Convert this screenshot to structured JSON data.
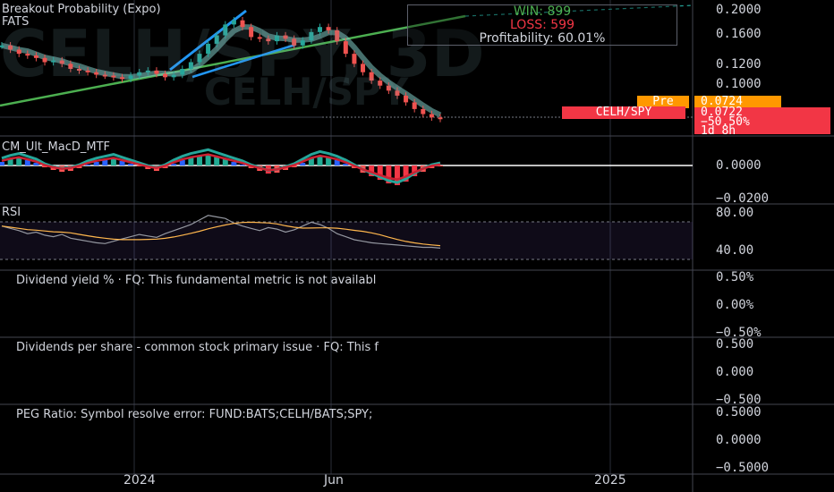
{
  "watermark": {
    "symbol": "CELH/SPY, 3D",
    "sub": "CELH/SPY"
  },
  "panes": {
    "main": {
      "title": "Breakout Probability (Expo)",
      "subtitle": "FATS"
    },
    "macd": {
      "title": "CM_Ult_MacD_MTF"
    },
    "rsi": {
      "title": "RSI"
    },
    "dividend_yield": {
      "title": "Dividend yield % · FQ: This fundamental metric is not availabl"
    },
    "dps": {
      "title": "Dividends per share - common stock primary issue · FQ: This f"
    },
    "peg": {
      "title": "PEG Ratio: Symbol resolve error: FUND:BATS;CELH/BATS;SPY;"
    }
  },
  "stats": {
    "win": "WIN: 899",
    "loss": "LOSS: 599",
    "profitability": "Profitability: 60.01%"
  },
  "badges": {
    "pre_label": "Pre",
    "pre_value": "0.0724",
    "symbol": "CELH/SPY",
    "last_value": "0.0722",
    "change": "−50.50%",
    "countdown": "1d 8h"
  },
  "scales": {
    "main": [
      "0.2000",
      "0.1600",
      "0.1200",
      "0.1000"
    ],
    "macd": [
      "0.0000",
      "−0.0200"
    ],
    "rsi": [
      "80.00",
      "40.00"
    ],
    "dividend_yield": [
      "0.50%",
      "0.00%",
      "−0.50%"
    ],
    "dps": [
      "0.500",
      "0.000",
      "−0.500"
    ],
    "peg": [
      "0.5000",
      "0.0000",
      "−0.5000"
    ]
  },
  "x_axis": [
    "2024",
    "Jun",
    "2025"
  ],
  "colors": {
    "background": "#000000",
    "grid": "#2a2e39",
    "bullish": "#26a69a",
    "bearish": "#ef5350",
    "trendline": "#2196f3",
    "support_line": "#4caf50",
    "rsi_line": "#9598a1",
    "rsi_ma": "#ffb74d",
    "pre_badge": "#ff9800",
    "price_badge": "#f23645",
    "win_text": "#4caf50",
    "loss_text": "#f23645"
  },
  "chart_data": {
    "type": "line",
    "series": [
      {
        "values": [
          0.16,
          0.155,
          0.15,
          0.148,
          0.145,
          0.14,
          0.142,
          0.138,
          0.132,
          0.13,
          0.128,
          0.125,
          0.124,
          0.122,
          0.12,
          0.124,
          0.128,
          0.13,
          0.126,
          0.122,
          0.125,
          0.132,
          0.14,
          0.15,
          0.162,
          0.172,
          0.185,
          0.19,
          0.182,
          0.17,
          0.168,
          0.165,
          0.172,
          0.168,
          0.16,
          0.166,
          0.176,
          0.182,
          0.178,
          0.165,
          0.15,
          0.138,
          0.128,
          0.118,
          0.112,
          0.106,
          0.1,
          0.092,
          0.084,
          0.078,
          0.074,
          0.0722
        ]
      }
    ],
    "ylim": [
      0.07,
      0.21
    ]
  }
}
